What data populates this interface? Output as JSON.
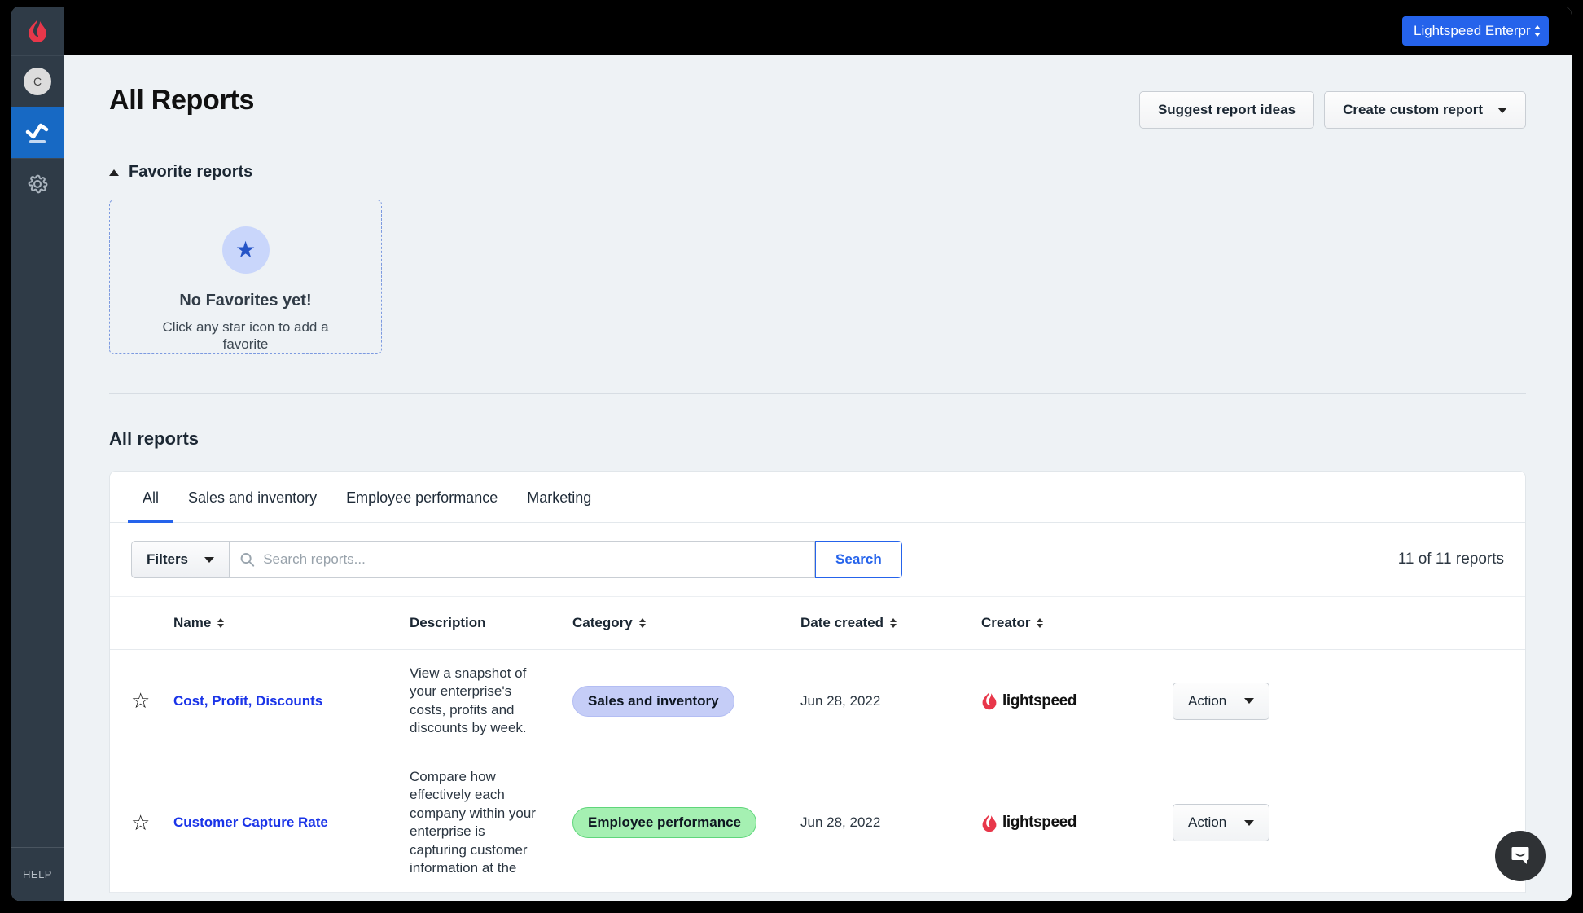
{
  "topbar": {
    "enterprise_selector": "Lightspeed Enterpr",
    "selector_icon": "up-down-chevron-icon"
  },
  "sidebar": {
    "logo_icon": "lightspeed-flame-logo",
    "avatar_initial": "C",
    "items": [
      {
        "icon": "trending-chart-icon",
        "name": "reports",
        "active": true
      },
      {
        "icon": "gear-icon",
        "name": "settings",
        "active": false
      }
    ],
    "help_label": "HELP"
  },
  "page": {
    "title": "All Reports",
    "suggest_button": "Suggest report ideas",
    "create_button": "Create custom report"
  },
  "favorites": {
    "section_label": "Favorite reports",
    "empty_title": "No Favorites yet!",
    "empty_subtitle": "Click any star icon to add a favorite",
    "star_icon": "star-filled-icon"
  },
  "all_reports": {
    "heading": "All reports",
    "tabs": [
      {
        "label": "All",
        "active": true
      },
      {
        "label": "Sales and inventory",
        "active": false
      },
      {
        "label": "Employee performance",
        "active": false
      },
      {
        "label": "Marketing",
        "active": false
      }
    ],
    "filters_label": "Filters",
    "search_placeholder": "Search reports...",
    "search_value": "",
    "search_button": "Search",
    "count_text": "11 of 11 reports",
    "columns": [
      {
        "label": "Name",
        "sortable": true
      },
      {
        "label": "Description",
        "sortable": false
      },
      {
        "label": "Category",
        "sortable": true
      },
      {
        "label": "Date created",
        "sortable": true
      },
      {
        "label": "Creator",
        "sortable": true
      }
    ],
    "action_label": "Action",
    "creator_name": "lightspeed",
    "rows": [
      {
        "name": "Cost, Profit, Discounts",
        "description": "View a snapshot of your enterprise's costs, profits and discounts by week.",
        "category": "Sales and inventory",
        "category_color": "blue",
        "date_created": "Jun 28, 2022",
        "creator": "lightspeed",
        "favorited": false
      },
      {
        "name": "Customer Capture Rate",
        "description": "Compare how effectively each company within your enterprise is capturing customer information at the",
        "category": "Employee performance",
        "category_color": "green",
        "date_created": "Jun 28, 2022",
        "creator": "lightspeed",
        "favorited": false
      }
    ]
  },
  "chat": {
    "icon": "intercom-messenger-icon"
  },
  "colors": {
    "accent_blue": "#2563eb",
    "link_blue": "#1a34e8",
    "brand_red": "#e8374a",
    "sidebar_dark": "#2f3b47",
    "badge_blue": "#c5cdf7",
    "badge_green": "#a5f0b2"
  }
}
